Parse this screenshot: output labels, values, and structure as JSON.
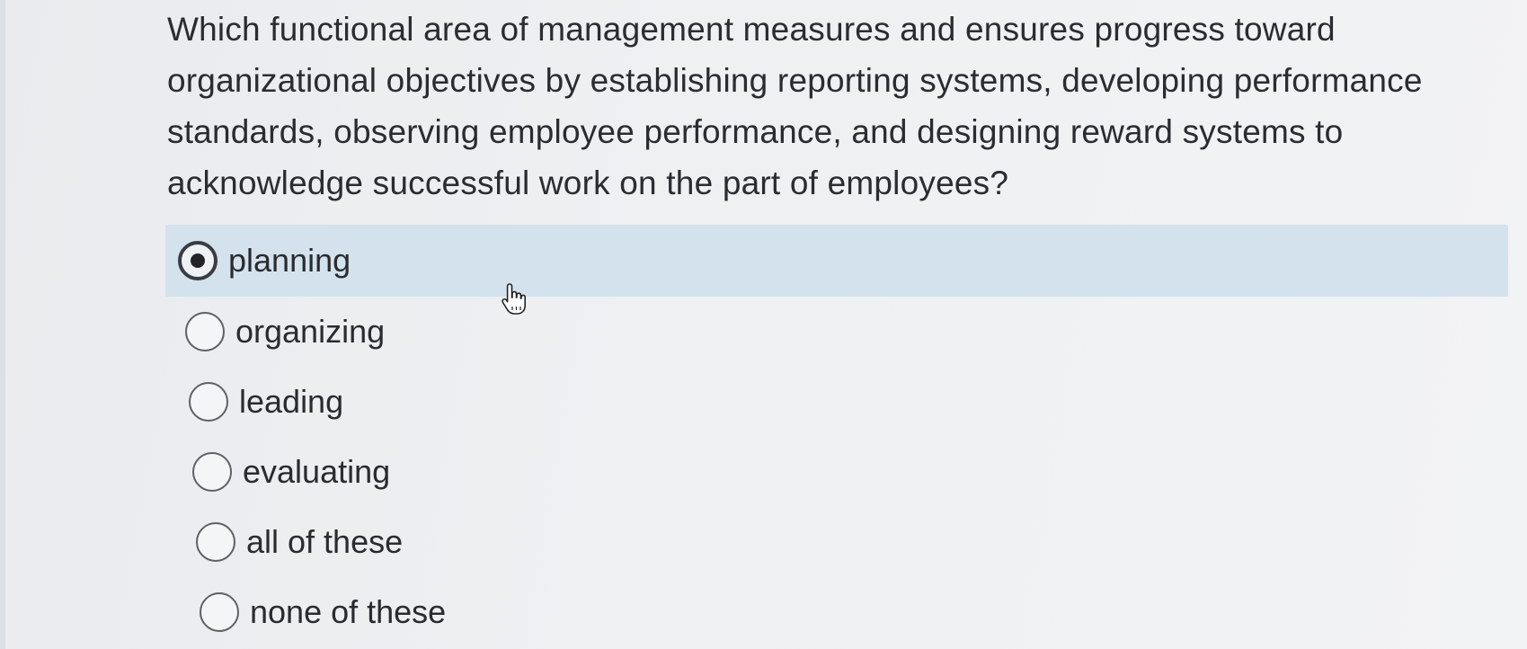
{
  "question": {
    "line1": "Which functional area of management measures and ensures progress toward",
    "line2": "organizational objectives by establishing reporting systems, developing performance",
    "line3": "standards, observing employee performance, and designing reward systems to",
    "line4": "acknowledge successful work on the part of employees?"
  },
  "options": [
    {
      "label": "planning",
      "selected": true
    },
    {
      "label": "organizing",
      "selected": false
    },
    {
      "label": "leading",
      "selected": false
    },
    {
      "label": "evaluating",
      "selected": false
    },
    {
      "label": "all of these",
      "selected": false
    },
    {
      "label": "none of these",
      "selected": false
    }
  ],
  "icons": {
    "cursor": "hand-pointer-icon"
  },
  "colors": {
    "selected_row": "#d3e2ec",
    "text": "#2a2b2e"
  }
}
